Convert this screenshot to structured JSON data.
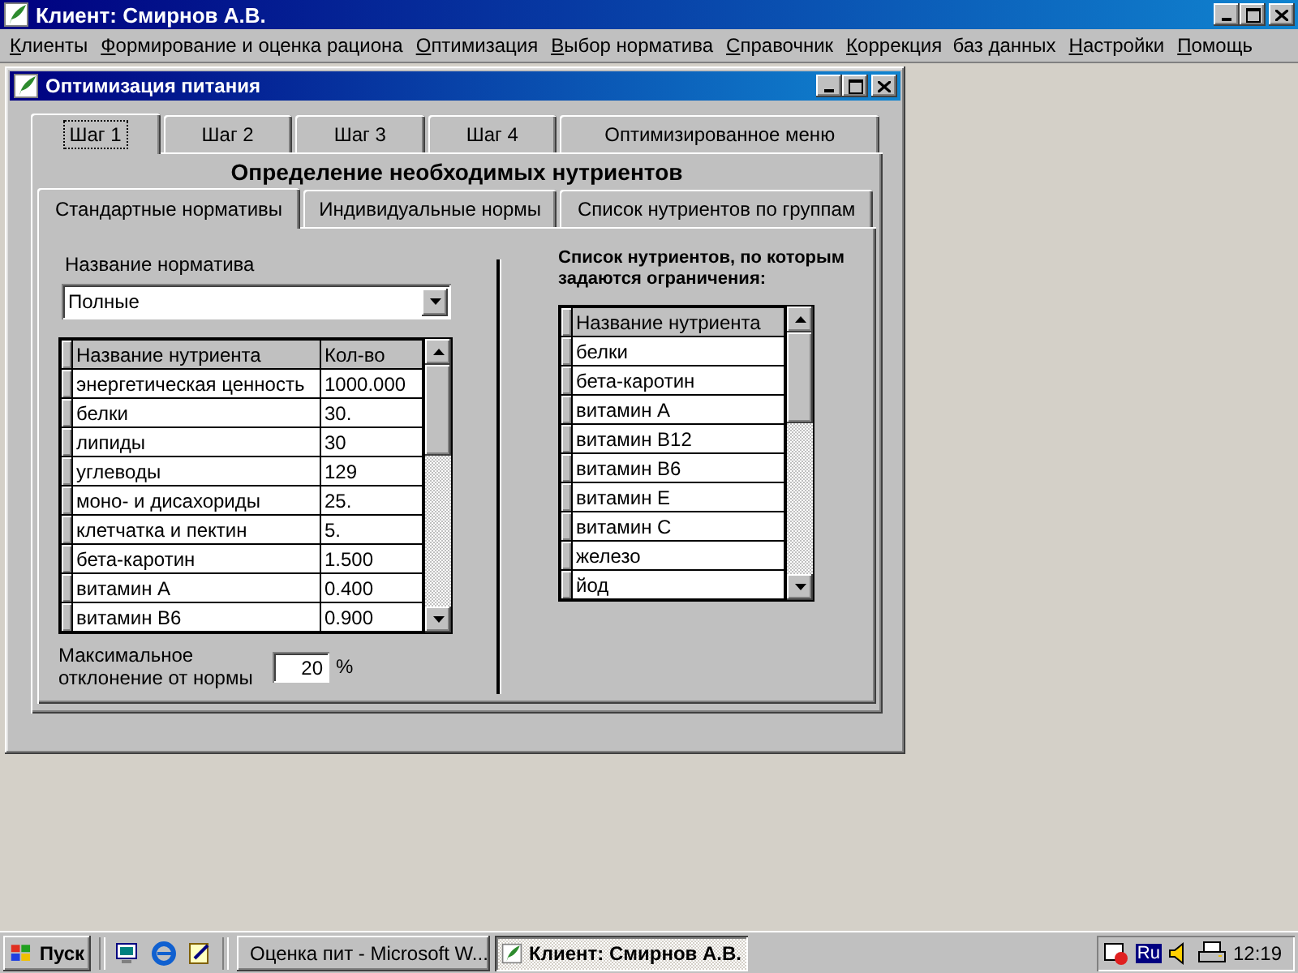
{
  "window": {
    "title": "Клиент: Смирнов А.В."
  },
  "menu": [
    {
      "label": "Клиенты"
    },
    {
      "label": "Формирование и оценка рациона"
    },
    {
      "label": "Оптимизация"
    },
    {
      "label": "Выбор норматива"
    },
    {
      "label": "Справочник"
    },
    {
      "label": "Коррекция  баз данных"
    },
    {
      "label": "Настройки"
    },
    {
      "label": "Помощь"
    }
  ],
  "child_window": {
    "title": "Оптимизация питания",
    "step_tabs": [
      {
        "label": "Шаг 1",
        "selected": true
      },
      {
        "label": "Шаг 2",
        "selected": false
      },
      {
        "label": "Шаг 3",
        "selected": false
      },
      {
        "label": "Шаг 4",
        "selected": false
      },
      {
        "label": "Оптимизированное меню",
        "selected": false
      }
    ],
    "heading": "Определение необходимых нутриентов",
    "sub_tabs": [
      {
        "label": "Стандартные нормативы",
        "selected": true
      },
      {
        "label": "Индивидуальные нормы",
        "selected": false
      },
      {
        "label": "Список нутриентов по группам",
        "selected": false
      }
    ],
    "norm_label": "Название норматива",
    "norm_select": {
      "value": "Полные"
    },
    "nutrient_table": {
      "columns": [
        "Название нутриента",
        "Кол-во"
      ],
      "rows": [
        [
          "энергетическая ценность",
          "1000.000"
        ],
        [
          "белки",
          "30."
        ],
        [
          "липиды",
          "30"
        ],
        [
          "углеводы",
          "129"
        ],
        [
          "моно- и дисахориды",
          "25."
        ],
        [
          "клетчатка и пектин",
          "5."
        ],
        [
          "бета-каротин",
          "1.500"
        ],
        [
          "витамин А",
          "0.400"
        ],
        [
          "витамин В6",
          "0.900"
        ]
      ]
    },
    "deviation_label": "Максимальное отклонение от нормы",
    "deviation_value": "20",
    "deviation_unit": "%",
    "constraint_label": "Список нутриентов, по которым задаются ограничения:",
    "constraint_table": {
      "columns": [
        "Название нутриента"
      ],
      "rows": [
        "белки",
        "бета-каротин",
        "витамин А",
        "витамин В12",
        "витамин В6",
        "витамин Е",
        "витамин С",
        "железо",
        "йод"
      ]
    }
  },
  "taskbar": {
    "start": "Пуск",
    "tasks": [
      {
        "label": "Оценка пит - Microsoft W...",
        "kind": "document",
        "selected": false
      },
      {
        "label": "Клиент: Смирнов А.В.",
        "kind": "app",
        "selected": true
      }
    ],
    "language": "Ru",
    "clock": "12:19"
  }
}
